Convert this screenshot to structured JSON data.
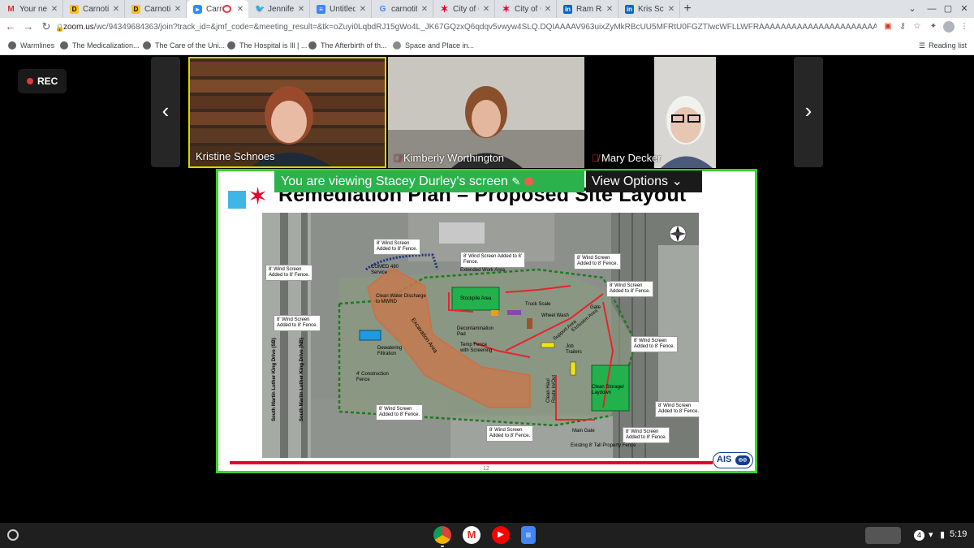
{
  "browser": {
    "tabs": [
      {
        "title": "Your next",
        "favicon": "gmail-icon"
      },
      {
        "title": "Carnotite",
        "favicon": "d-icon"
      },
      {
        "title": "Carnotite",
        "favicon": "d-icon"
      },
      {
        "title": "Carn",
        "favicon": "zoom-icon",
        "active": true
      },
      {
        "title": "Jennifer",
        "favicon": "twitter-icon"
      },
      {
        "title": "Untitled",
        "favicon": "docs-icon"
      },
      {
        "title": "carnotite",
        "favicon": "google-icon"
      },
      {
        "title": "City of C",
        "favicon": "chicago-star-icon"
      },
      {
        "title": "City of C",
        "favicon": "chicago-star-icon"
      },
      {
        "title": "Ram Ra",
        "favicon": "linkedin-icon"
      },
      {
        "title": "Kris Sch",
        "favicon": "linkedin-icon"
      }
    ],
    "url_host": "zoom.us",
    "url_rest": "/wc/94349684363/join?track_id=&jmf_code=&meeting_result=&tk=oZuyi0LqbdRJ15gWo4L_JK67GQzxQ6qdqv5vwyw4SLQ.DQIAAAAV963uixZyMkRBcUU5MFRtU0FGZTlwcWFLLWFRAAAAAAAAAAAAAAAAAAAAAAAAAAAAAA&cap..."
  },
  "bookmarks": [
    {
      "label": "Warmlines"
    },
    {
      "label": "The Medicalization..."
    },
    {
      "label": "The Care of the Uni..."
    },
    {
      "label": "The Hospital is Ill | ..."
    },
    {
      "label": "The Afterbirth of th..."
    },
    {
      "label": "Space and Place in..."
    }
  ],
  "reading_list": "Reading list",
  "meeting": {
    "rec_label": "REC",
    "participants": [
      {
        "name": "Kristine Schnoes",
        "speaking": true,
        "muted": false
      },
      {
        "name": "Kimberly Worthington",
        "speaking": false,
        "muted": true
      },
      {
        "name": "Mary Decker",
        "speaking": false,
        "muted": true
      }
    ],
    "share_banner": "You are viewing Stacey Durley's screen",
    "view_options": "View Options"
  },
  "slide": {
    "title": "Remediation Plan – Proposed Site Layout",
    "page_number": "12",
    "logo_text": "AIS",
    "callouts": [
      "8' Wind Screen\nAdded to 8' Fence.",
      "8' Wind Screen Added to 8'\nFence.",
      "8' Wind Screen\nAdded to 8' Fence.",
      "8' Wind Screen\nAdded to 8' Fence.",
      "8' Wind Screen\nAdded to 8' Fence.",
      "8' Wind Screen\nAdded to 8' Fence.",
      "8' Wind Screen\nAdded to 8' Fence.",
      "8' Wind Screen\nAdded to 8' Fence.",
      "8' Wind Screen\nAdded to 8' Fence.",
      "8' Wind Screen\nAdded to 8' Fence."
    ],
    "labels": {
      "comed": "COMED 480\nService",
      "extended_work": "Extended Work Area",
      "stockpile": "Stockpile Area",
      "clean_water": "Clean Water Discharge\nto MWRD",
      "truck_scale": "Truck Scale",
      "wheel_wash": "Wheel Wash",
      "exclusion": "Exclusion Area",
      "support": "Support Area",
      "decon": "Decontamination\nPad",
      "dewatering": "Dewatering\nFiltration",
      "excavation": "Excavation Area",
      "temp_fence": "Temp Fence\nwith Screening",
      "job_trailers": "Job\nTrailers",
      "construction_fence": "4' Construction\nFence",
      "clean_haul": "Clean Haul\nRoute In/Out",
      "clean_storage": "Clean Storage/\nLaydown",
      "gate": "Gate",
      "main_gate": "Main Gate",
      "existing_fence": "Existing 8' Tall Property Fence",
      "mlk_sb": "South Martin Luther King Drive (SB)",
      "mlk_nb": "South Martin Luther King Drive (NB)"
    }
  },
  "shelf": {
    "apps": [
      "chrome-icon",
      "gmail-icon",
      "youtube-icon",
      "docs-icon"
    ],
    "notification_count": "4",
    "time": "5:19"
  },
  "colors": {
    "zoom_green": "#2bb24c",
    "share_border": "#39d32e",
    "chicago_red": "#e4002b",
    "chicago_blue": "#41b6e6",
    "speaking_border": "#d9d400"
  }
}
